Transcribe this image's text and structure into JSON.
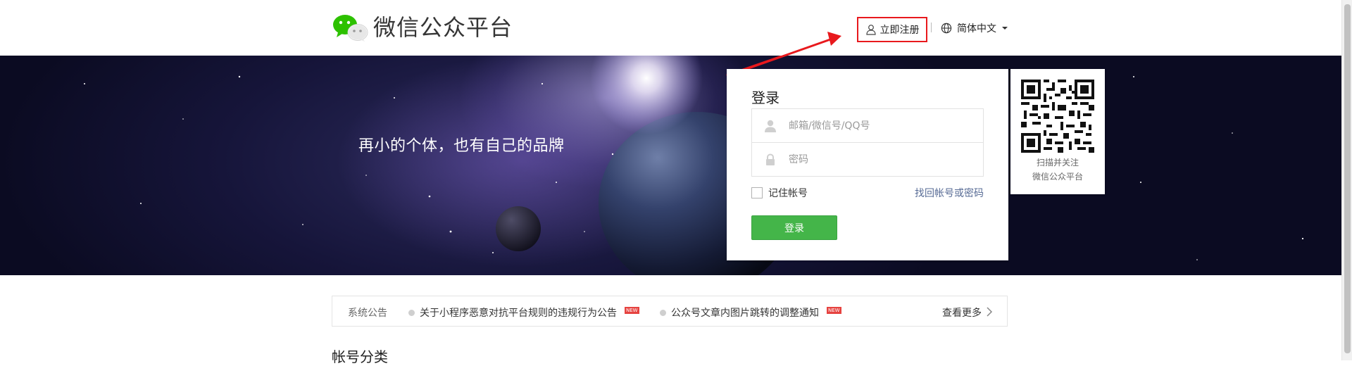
{
  "header": {
    "brand": "微信公众平台",
    "logo_icon": "wechat-logo-icon",
    "register_label": "立即注册",
    "register_icon": "user-icon",
    "language_label": "简体中文",
    "language_icon": "globe-icon"
  },
  "banner": {
    "slogan": "再小的个体，也有自己的品牌"
  },
  "login": {
    "title": "登录",
    "account_placeholder": "邮箱/微信号/QQ号",
    "password_placeholder": "密码",
    "remember_label": "记住帐号",
    "forgot_label": "找回帐号或密码",
    "submit_label": "登录"
  },
  "qr": {
    "line1": "扫描并关注",
    "line2": "微信公众平台"
  },
  "notices": {
    "label": "系统公告",
    "items": [
      {
        "text": "关于小程序恶意对抗平台规则的违规行为公告",
        "badge": "NEW"
      },
      {
        "text": "公众号文章内图片跳转的调整通知",
        "badge": "NEW"
      }
    ],
    "more_label": "查看更多"
  },
  "section": {
    "title": "帐号分类"
  },
  "colors": {
    "primary_green": "#44b549",
    "link_blue": "#576b95",
    "highlight_red": "#e8191d",
    "badge_red": "#e64340"
  }
}
